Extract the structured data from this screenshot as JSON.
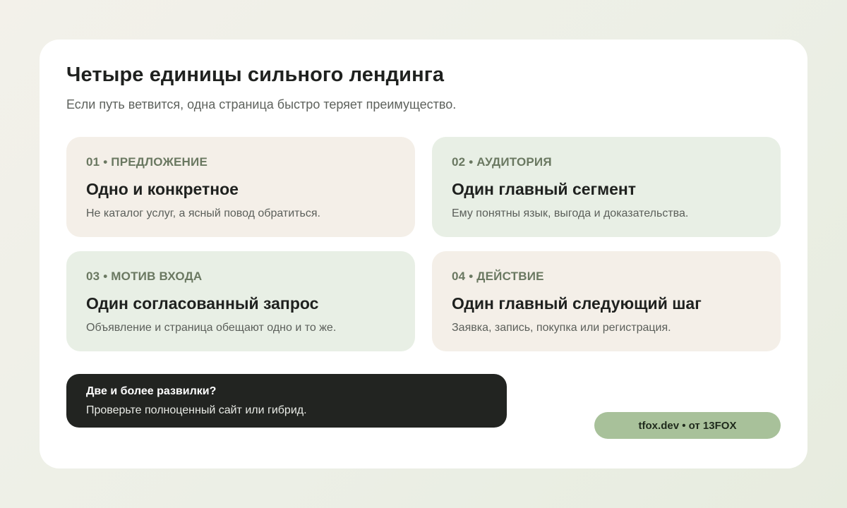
{
  "header": {
    "title": "Четыре единицы сильного лендинга",
    "subtitle": "Если путь ветвится, одна страница быстро теряет преимущество."
  },
  "tiles": [
    {
      "label": "01 • ПРЕДЛОЖЕНИЕ",
      "heading": "Одно и конкретное",
      "text": "Не каталог услуг, а ясный повод обратиться."
    },
    {
      "label": "02 • АУДИТОРИЯ",
      "heading": "Один главный сегмент",
      "text": "Ему понятны язык, выгода и доказательства."
    },
    {
      "label": "03 • МОТИВ ВХОДА",
      "heading": "Один согласованный запрос",
      "text": "Объявление и страница обещают одно и то же."
    },
    {
      "label": "04 • ДЕЙСТВИЕ",
      "heading": "Один главный следующий шаг",
      "text": "Заявка, запись, покупка или регистрация."
    }
  ],
  "callout": {
    "title": "Две и более развилки?",
    "text": "Проверьте полноценный сайт или гибрид."
  },
  "badge": {
    "text": "tfox.dev • от 13FOX"
  },
  "colors": {
    "tile_beige": "#f4efe8",
    "tile_green": "#e8efe5",
    "callout_bg": "#222421",
    "badge_bg": "#a8c19a",
    "label_accent": "#6a7861"
  }
}
